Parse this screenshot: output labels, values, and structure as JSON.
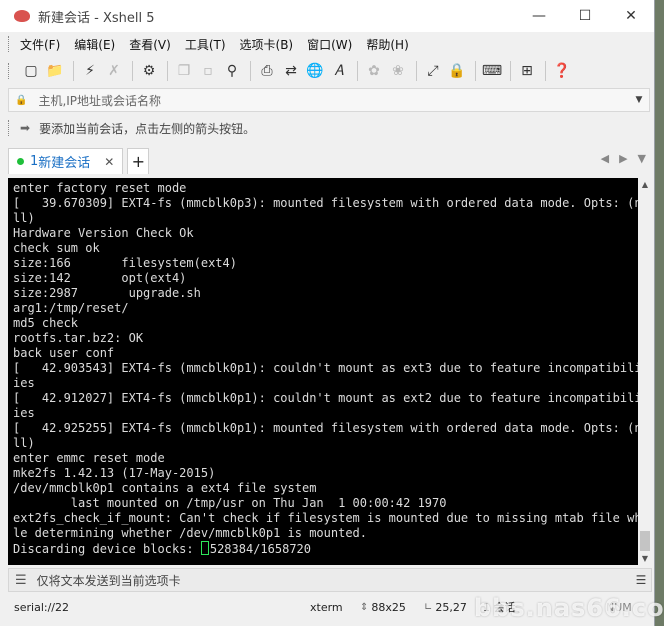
{
  "window": {
    "title": "新建会话 - Xshell 5"
  },
  "menu": [
    {
      "label": "文件(F)"
    },
    {
      "label": "编辑(E)"
    },
    {
      "label": "查看(V)"
    },
    {
      "label": "工具(T)"
    },
    {
      "label": "选项卡(B)"
    },
    {
      "label": "窗口(W)"
    },
    {
      "label": "帮助(H)"
    }
  ],
  "address": {
    "placeholder": "主机,IP地址或会话名称"
  },
  "hint": {
    "text": "要添加当前会话，点击左侧的箭头按钮。"
  },
  "tab": {
    "index": "1",
    "label": "新建会话"
  },
  "terminal": {
    "lines": [
      "enter factory reset mode",
      "[   39.670309] EXT4-fs (mmcblk0p3): mounted filesystem with ordered data mode. Opts: (nu",
      "ll)",
      "Hardware Version Check Ok",
      "check sum ok",
      "size:166       filesystem(ext4)",
      "size:142       opt(ext4)",
      "size:2987       upgrade.sh",
      "arg1:/tmp/reset/",
      "md5 check",
      "rootfs.tar.bz2: OK",
      "back user conf",
      "[   42.903543] EXT4-fs (mmcblk0p1): couldn't mount as ext3 due to feature incompatibilit",
      "ies",
      "[   42.912027] EXT4-fs (mmcblk0p1): couldn't mount as ext2 due to feature incompatibilit",
      "ies",
      "[   42.925255] EXT4-fs (mmcblk0p1): mounted filesystem with ordered data mode. Opts: (nu",
      "ll)",
      "enter emmc reset mode",
      "mke2fs 1.42.13 (17-May-2015)",
      "/dev/mmcblk0p1 contains a ext4 file system",
      "        last mounted on /tmp/usr on Thu Jan  1 00:00:42 1970",
      "ext2fs_check_if_mount: Can't check if filesystem is mounted due to missing mtab file whi",
      "le determining whether /dev/mmcblk0p1 is mounted.",
      "Discarding device blocks: "
    ],
    "progress": "528384/1658720"
  },
  "sendbar": {
    "text": "仅将文本发送到当前选项卡"
  },
  "status": {
    "connection": "serial://22",
    "term": "xterm",
    "size": "88x25",
    "position": "25,27",
    "sessions": "1 会话",
    "num": "NUM"
  },
  "watermark": {
    "text": "bbs.nas66.com"
  }
}
